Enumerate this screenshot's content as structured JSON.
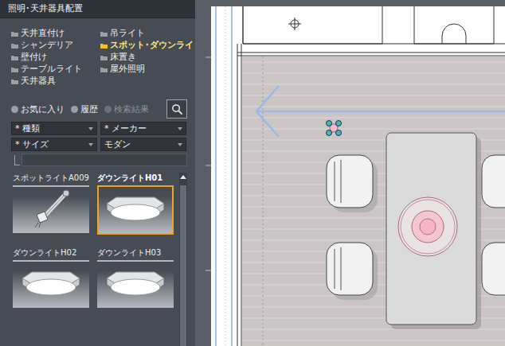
{
  "window": {
    "title": "照明･天井器具配置"
  },
  "categories": [
    {
      "label": "天井直付け",
      "selected": false
    },
    {
      "label": "吊ライト",
      "selected": false
    },
    {
      "label": "シャンデリア",
      "selected": false
    },
    {
      "label": "スポット･ダウンライト",
      "selected": true
    },
    {
      "label": "壁付け",
      "selected": false
    },
    {
      "label": "床置き",
      "selected": false
    },
    {
      "label": "テーブルライト",
      "selected": false
    },
    {
      "label": "屋外照明",
      "selected": false
    },
    {
      "label": "天井器具",
      "selected": false
    }
  ],
  "tabs": [
    {
      "label": "お気に入り",
      "selected": false,
      "disabled": false
    },
    {
      "label": "履歴",
      "selected": false,
      "disabled": false
    },
    {
      "label": "検索結果",
      "selected": false,
      "disabled": true
    }
  ],
  "filters": [
    "* 種類",
    "* メーカー",
    "* サイズ",
    "モダン"
  ],
  "items": [
    {
      "label": "スポットライトA009",
      "selected": false,
      "kind": "spot"
    },
    {
      "label": "ダウンライトH01",
      "selected": true,
      "kind": "ceiling"
    },
    {
      "label": "ダウンライトH02",
      "selected": false,
      "kind": "ceiling"
    },
    {
      "label": "ダウンライトH03",
      "selected": false,
      "kind": "ceiling"
    }
  ]
}
